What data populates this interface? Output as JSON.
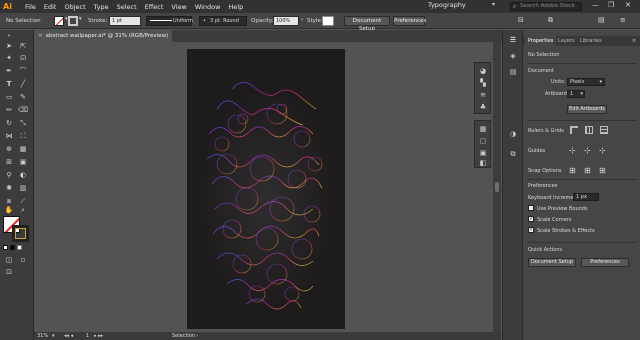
{
  "app": {
    "logo": "Ai",
    "accent": "#ff9a00"
  },
  "menubar": {
    "items": [
      "File",
      "Edit",
      "Object",
      "Type",
      "Select",
      "Effect",
      "View",
      "Window",
      "Help"
    ],
    "workspace": "Typography",
    "search_placeholder": "Search Adobe Stock",
    "window_controls": [
      "—",
      "❐",
      "✕"
    ]
  },
  "controlbar": {
    "selection": "No Selection",
    "stroke_label": "Stroke:",
    "stroke_weight": "1 pt",
    "profile": "Uniform",
    "brush": "3 pt. Round",
    "opacity_label": "Opacity:",
    "opacity": "100%",
    "style_label": "Style:",
    "doc_setup": "Document Setup",
    "preferences": "Preferences"
  },
  "document": {
    "tab_title": "abstract wallpaper.ai* @ 31% (RGB/Preview)",
    "zoom": "31%",
    "page": "1",
    "status": "Selection"
  },
  "panel": {
    "tabs": [
      "Properties",
      "Layers",
      "Libraries"
    ],
    "no_selection": "No Selection",
    "document_label": "Document",
    "units_label": "Units:",
    "units_value": "Pixels",
    "artboard_label": "Artboard:",
    "artboard_value": "1",
    "edit_artboards": "Edit Artboards",
    "rulers_grids": "Rulers & Grids",
    "guides": "Guides",
    "snap_options": "Snap Options",
    "preferences": "Preferences",
    "keyboard_increment_label": "Keyboard Increment:",
    "keyboard_increment_value": "1 px",
    "use_preview_bounds": "Use Preview Bounds",
    "scale_corners": "Scale Corners",
    "scale_strokes": "Scale Strokes & Effects",
    "quick_actions": "Quick Actions",
    "doc_setup": "Document Setup",
    "prefs_btn": "Preferences"
  }
}
